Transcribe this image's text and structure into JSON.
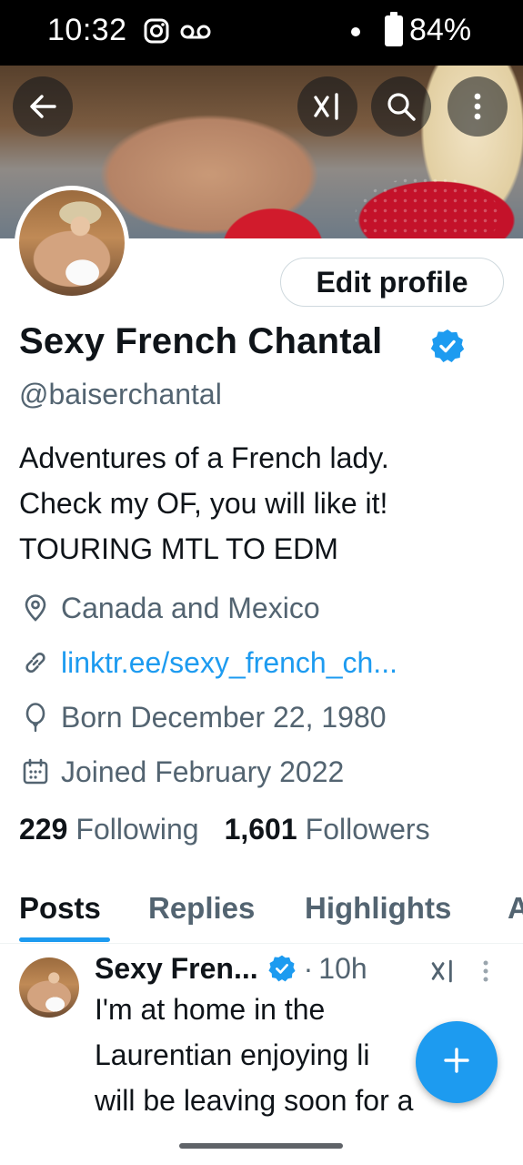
{
  "status_bar": {
    "time": "10:32",
    "battery": "84%"
  },
  "icons": {
    "back": "arrow-left-icon",
    "xai": "grok-icon",
    "search": "search-icon",
    "more": "more-vertical-icon",
    "verified": "verified-badge-icon",
    "location": "location-pin-icon",
    "link": "link-icon",
    "birthday": "balloon-icon",
    "joined": "calendar-icon",
    "compose": "plus-icon"
  },
  "profile": {
    "edit_label": "Edit profile",
    "display_name": "Sexy French Chantal",
    "handle": "@baiserchantal",
    "bio_lines": [
      "Adventures of a French lady.",
      "Check my OF, you will like it!",
      "TOURING MTL TO EDM"
    ],
    "location": "Canada and Mexico",
    "website": "linktr.ee/sexy_french_ch...",
    "born": "Born December 22, 1980",
    "joined": "Joined February 2022",
    "following_count": "229",
    "following_label": "Following",
    "followers_count": "1,601",
    "followers_label": "Followers"
  },
  "tabs": [
    {
      "label": "Posts"
    },
    {
      "label": "Replies"
    },
    {
      "label": "Highlights"
    },
    {
      "label": "A"
    }
  ],
  "post": {
    "name": "Sexy Fren...",
    "time": "10h",
    "text_lines": [
      "I'm at home in the",
      "Laurentian enjoying li",
      "will be leaving soon for a"
    ]
  },
  "colors": {
    "accent": "#1d9bf0",
    "text": "#0f1419",
    "secondary": "#536471"
  }
}
